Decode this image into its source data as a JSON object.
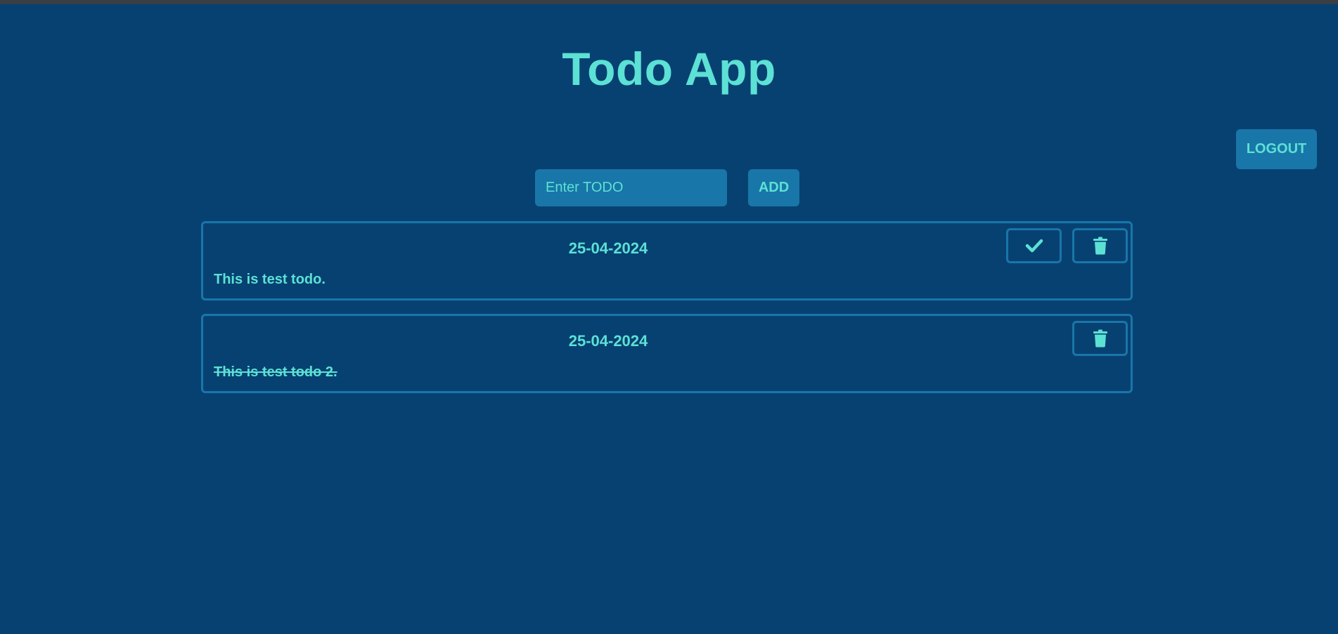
{
  "app": {
    "title": "Todo App"
  },
  "header": {
    "logout_label": "LOGOUT"
  },
  "form": {
    "input_value": "",
    "input_placeholder": "Enter TODO",
    "add_label": "ADD"
  },
  "todos": [
    {
      "date": "25-04-2024",
      "text": "This is test todo.",
      "completed": false,
      "actions": [
        "check-icon",
        "trash-icon"
      ]
    },
    {
      "date": "25-04-2024",
      "text": "This is test todo 2.",
      "completed": true,
      "actions": [
        "trash-icon"
      ]
    }
  ],
  "colors": {
    "background": "#074172",
    "accent": "#5ce1d4",
    "button": "#1976a8",
    "topbar": "#3a3f44"
  }
}
